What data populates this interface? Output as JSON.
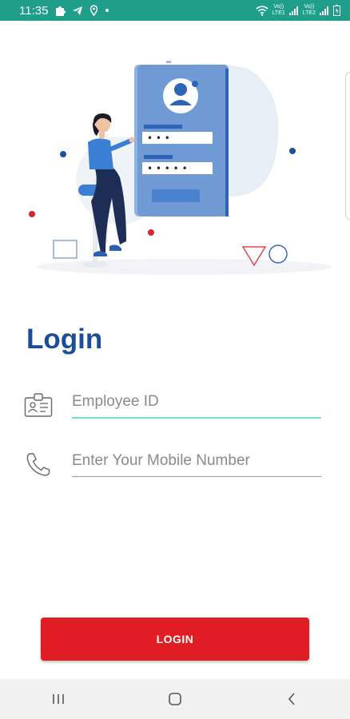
{
  "status_bar": {
    "time": "11:35",
    "icons": [
      "puzzle-icon",
      "telegram-icon",
      "location-icon",
      "dot-icon"
    ],
    "right_icons": [
      "wifi-icon",
      "volte-lte-signal-icon",
      "volte-lte-signal-icon",
      "battery-icon"
    ],
    "volte_label": "Vo))",
    "lte_label": "LTE1",
    "lte2_label": "LTE2",
    "color": "#1f9e8a"
  },
  "hero": {
    "illustration": "person-login-illustration",
    "password_masks": [
      "• • •",
      "• • • • •"
    ]
  },
  "login": {
    "title": "Login",
    "title_color": "#1b4d9b",
    "employee_id": {
      "icon": "id-card-icon",
      "placeholder": "Employee ID",
      "value": ""
    },
    "mobile": {
      "icon": "phone-icon",
      "placeholder": "Enter Your Mobile Number",
      "value": ""
    },
    "button_label": "LOGIN",
    "button_color": "#e01d23"
  },
  "nav_bar": {
    "items": [
      "recent-apps-icon",
      "home-icon",
      "back-icon"
    ]
  }
}
